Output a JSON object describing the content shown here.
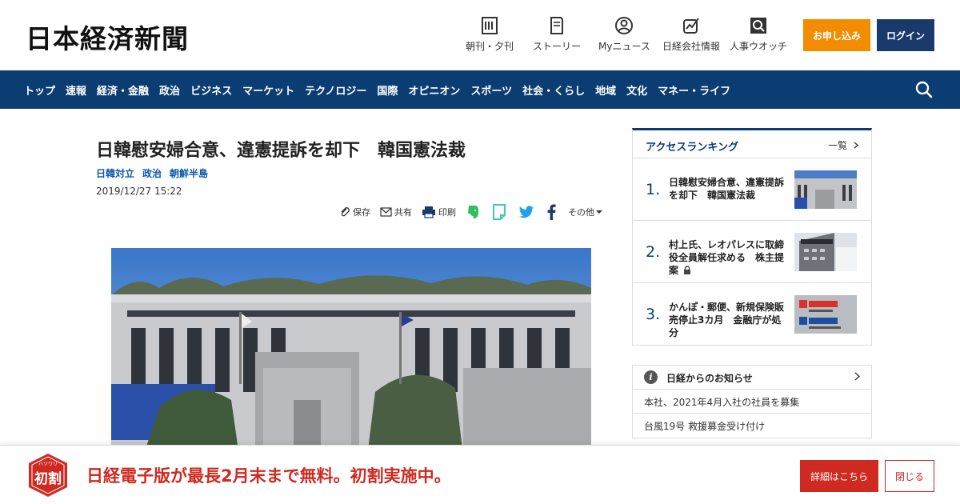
{
  "header": {
    "logo": "日本経済新聞",
    "utilities": [
      {
        "label": "朝刊・夕刊",
        "icon": "newspaper-icon"
      },
      {
        "label": "ストーリー",
        "icon": "book-icon"
      },
      {
        "label": "Myニュース",
        "icon": "user-icon"
      },
      {
        "label": "日経会社情報",
        "icon": "chart-icon"
      },
      {
        "label": "人事ウオッチ",
        "icon": "search-person-icon"
      }
    ],
    "subscribe_label": "お申し込み",
    "login_label": "ログイン"
  },
  "nav": {
    "items": [
      "トップ",
      "速報",
      "経済・金融",
      "政治",
      "ビジネス",
      "マーケット",
      "テクノロジー",
      "国際",
      "オピニオン",
      "スポーツ",
      "社会・くらし",
      "地域",
      "文化",
      "マネー・ライフ"
    ]
  },
  "article": {
    "title": "日韓慰安婦合意、違憲提訴を却下　韓国憲法裁",
    "tags": [
      "日韓対立",
      "政治",
      "朝鮮半島"
    ],
    "date": "2019/12/27 15:22",
    "share": {
      "save": "保存",
      "share": "共有",
      "print": "印刷",
      "more": "その他"
    }
  },
  "ranking": {
    "title": "アクセスランキング",
    "more": "一覧",
    "items": [
      {
        "num": "1.",
        "text": "日韓慰安婦合意、違憲提訴を却下　韓国憲法裁"
      },
      {
        "num": "2.",
        "text": "村上氏、レオパレスに取締役全員解任求める　株主提案"
      },
      {
        "num": "3.",
        "text": "かんぽ・郵便、新規保険販売停止3カ月　金融庁が処分"
      }
    ]
  },
  "notice": {
    "title": "日経からのお知らせ",
    "items": [
      "本社、2021年4月入社の社員を募集",
      "台風19号 救援募金受け付け"
    ]
  },
  "promo": {
    "badge_text": "初割",
    "badge_ruby": "ハツワリ",
    "text": "日経電子版が最長2月末まで無料。初割実施中。",
    "details_label": "詳細はこちら",
    "close_label": "閉じる"
  },
  "colors": {
    "nav": "#0b3d73",
    "subscribe": "#f28c00",
    "login": "#1a3a6b",
    "promo": "#cf2a21",
    "tag": "#0d5aa7"
  }
}
